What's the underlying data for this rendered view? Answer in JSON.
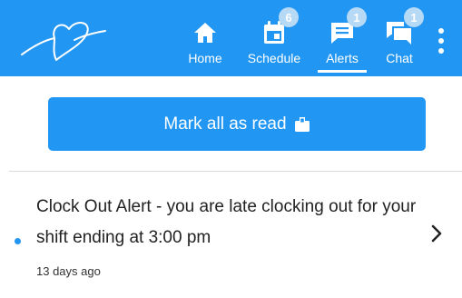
{
  "nav": {
    "home_label": "Home",
    "schedule_label": "Schedule",
    "schedule_badge": "6",
    "alerts_label": "Alerts",
    "alerts_badge": "1",
    "chat_label": "Chat",
    "chat_badge": "1",
    "active_tab": "Alerts",
    "icons": [
      "heart-logo",
      "home-icon",
      "calendar-icon",
      "alerts-message-icon",
      "chat-icon",
      "more-vertical-icon"
    ]
  },
  "actions": {
    "mark_all_read_label": "Mark all as read",
    "mark_all_read_icon": "envelope-open-icon"
  },
  "alerts": [
    {
      "text": "Clock Out Alert - you are late clocking out for your shift ending at 3:00 pm",
      "time": "13 days ago",
      "unread": true
    }
  ],
  "colors": {
    "primary": "#2196f3",
    "badge": "#b6d9f6",
    "text": "#222222"
  }
}
